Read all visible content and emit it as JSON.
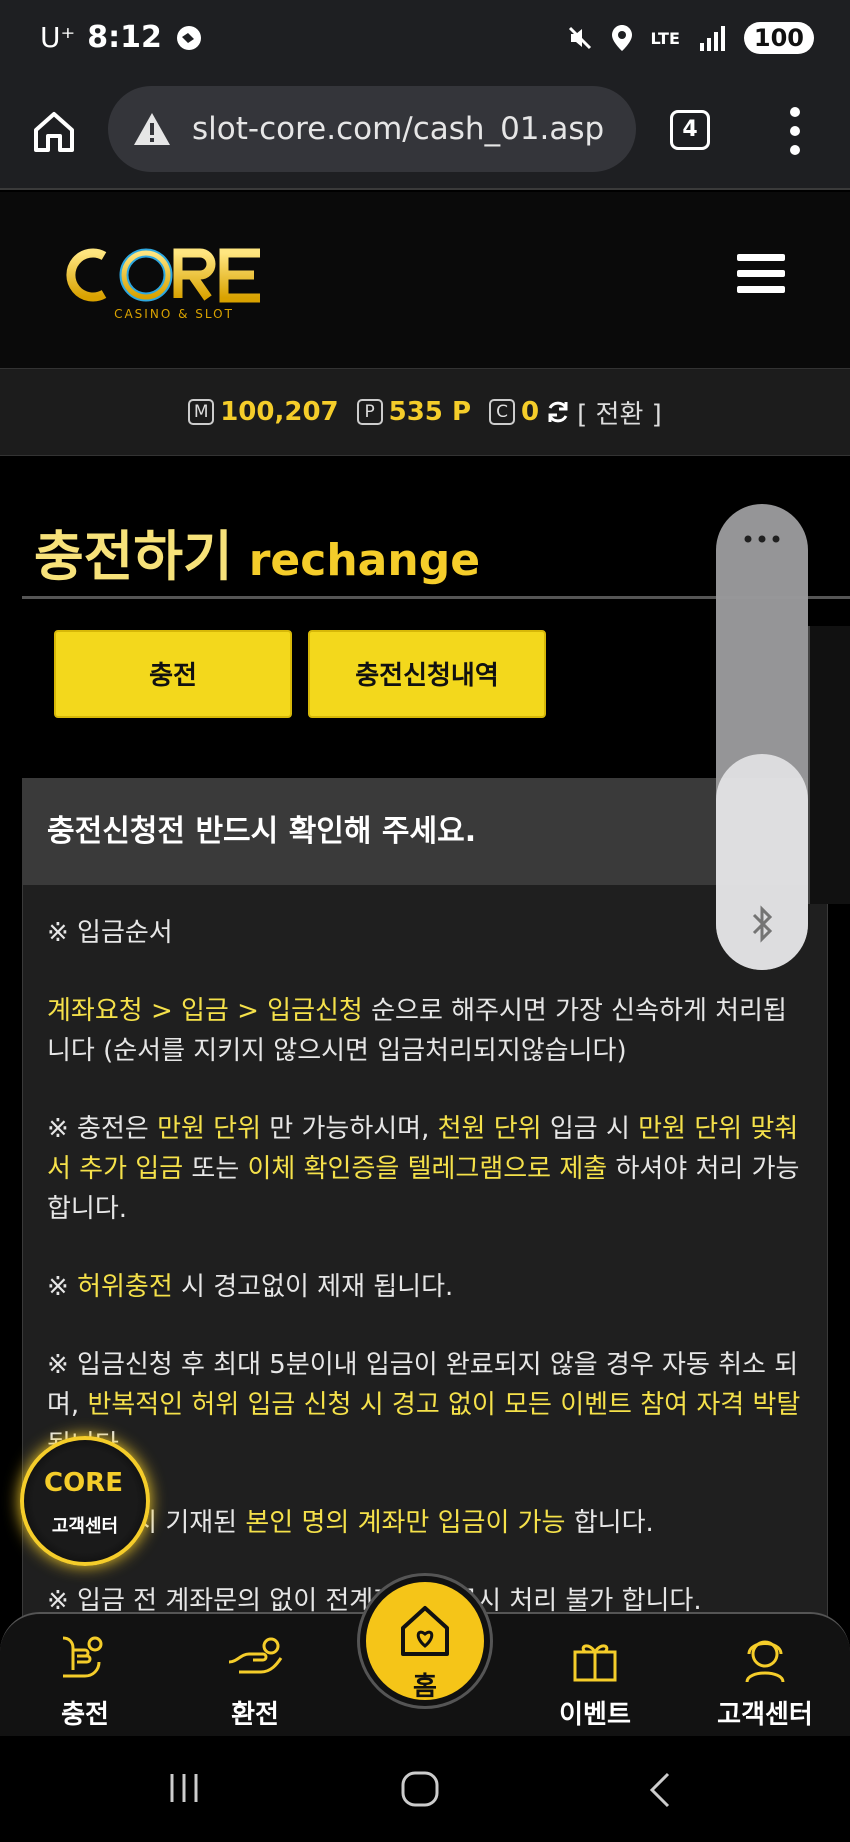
{
  "status_bar": {
    "carrier": "U⁺",
    "time": "8:12",
    "network": "LTE",
    "battery": "100"
  },
  "browser": {
    "url": "slot-core.com/cash_01.asp",
    "tab_count": "4"
  },
  "header": {
    "logo_text": "CORE",
    "logo_sub": "CASINO & SLOT"
  },
  "points": {
    "m_badge": "M",
    "m_value": "100,207",
    "p_badge": "P",
    "p_value": "535 P",
    "c_badge": "C",
    "c_value": "0",
    "switch_label": "[ 전환 ]"
  },
  "page": {
    "title_ko": "충전하기",
    "title_en": "rechange"
  },
  "buttons": {
    "charge": "충전",
    "history": "충전신청내역"
  },
  "notice": {
    "heading": "충전신청전 반드시 확인해 주세요.",
    "p1": "※ 입금순서",
    "p2_hl": "계좌요청 > 입금 > 입금신청",
    "p2_rest": " 순으로 해주시면 가장 신속하게 처리됩니다 (순서를 지키지 않으시면 입금처리되지않습니다)",
    "p3_a": "※ 충전은 ",
    "p3_b": "만원 단위",
    "p3_c": " 만 가능하시며, ",
    "p3_d": "천원 단위",
    "p3_e": " 입금 시 ",
    "p3_f": "만원 단위 맞춰서 추가 입금",
    "p3_g": " 또는 ",
    "p3_h": "이체 확인증을 텔레그램으로 제출",
    "p3_i": " 하셔야 처리 가능합니다.",
    "p4_a": "※ ",
    "p4_b": "허위충전",
    "p4_c": " 시 경고없이 제재 됩니다.",
    "p5_a": "※ 입금신청 후 최대 5분이내 입금이 완료되지 않을 경우 자동 취소 되며, ",
    "p5_b": "반복적인 허위 입금 신청 시 경고 없이 모든 이벤트 참여 자격 박탈",
    "p5_c": "됩니다.",
    "p6_a": "※ 가입 시 기재된 ",
    "p6_b": "본인 명의 계좌만 입금이 가능",
    "p6_c": " 합니다.",
    "p7": "※ 입금 전 계좌문의 없이 전계좌로 입금시 처리 불가 합니다."
  },
  "cs_bubble": {
    "logo": "CORE",
    "label": "고객센터"
  },
  "bottom_nav": {
    "charge": "충전",
    "exchange": "환전",
    "home": "홈",
    "event": "이벤트",
    "support": "고객센터"
  },
  "colors": {
    "accent": "#f5cd2a",
    "button": "#f3d81c",
    "highlight": "#f5e14a"
  }
}
